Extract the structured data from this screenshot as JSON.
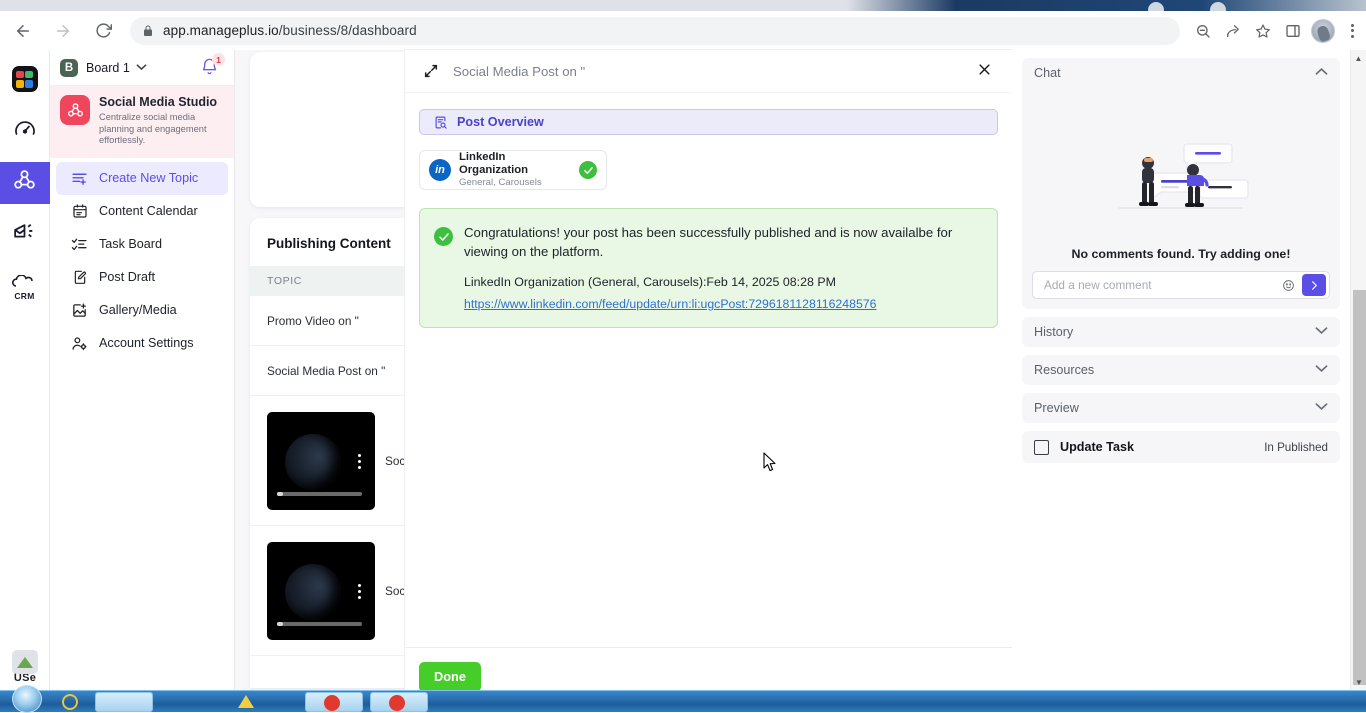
{
  "browser": {
    "url_host": "app.manageplus.io",
    "url_path": "/business/8/dashboard",
    "back_icon": "back-arrow-icon",
    "forward_icon": "forward-arrow-icon",
    "reload_icon": "reload-icon",
    "lock_icon": "lock-icon",
    "zoom_icon": "zoom-out-icon",
    "share_icon": "share-icon",
    "bookmark_icon": "star-icon",
    "sidepanel_icon": "side-panel-icon",
    "profile_icon": "avatar-icon",
    "menu_icon": "three-dot-menu-icon"
  },
  "rail": {
    "items": [
      {
        "name": "app-logo",
        "icon": "grid-logo-icon"
      },
      {
        "name": "dashboard",
        "icon": "speedometer-icon"
      },
      {
        "name": "social-media-studio",
        "icon": "people-group-icon",
        "active": true
      },
      {
        "name": "campaigns",
        "icon": "megaphone-mail-icon"
      },
      {
        "name": "crm",
        "icon": "crm-cloud-icon"
      }
    ],
    "bottom_label": "USe"
  },
  "sidebar": {
    "board_badge": "B",
    "board_name": "Board 1",
    "board_caret": "▾",
    "notification_count": "1",
    "studio": {
      "title": "Social Media Studio",
      "subtitle": "Centralize social media planning and engagement effortlessly."
    },
    "items": [
      {
        "label": "Create New Topic",
        "icon": "list-plus-icon",
        "active": true
      },
      {
        "label": "Content Calendar",
        "icon": "calendar-icon",
        "active": false
      },
      {
        "label": "Task Board",
        "icon": "checklist-icon",
        "active": false
      },
      {
        "label": "Post Draft",
        "icon": "document-edit-icon",
        "active": false
      },
      {
        "label": "Gallery/Media",
        "icon": "image-plus-icon",
        "active": false
      },
      {
        "label": "Account Settings",
        "icon": "user-gear-icon",
        "active": false
      }
    ]
  },
  "publishing": {
    "title": "Publishing Content",
    "column_header": "TOPIC",
    "rows": [
      {
        "topic": "Promo Video on \"",
        "type": "text"
      },
      {
        "topic": "Social Media Post on \"",
        "type": "text"
      },
      {
        "topic": "Soc",
        "type": "media"
      },
      {
        "topic": "Soc",
        "type": "media"
      }
    ]
  },
  "modal": {
    "title": "Social Media Post on \"",
    "expand_icon": "expand-arrows-icon",
    "close_icon": "close-x-icon",
    "section_label": "Post Overview",
    "section_icon": "document-search-icon",
    "account": {
      "platform_icon": "linkedin-icon",
      "platform_short": "in",
      "name": "LinkedIn Organization",
      "subtitle": "General, Carousels",
      "status_icon": "check-circle-icon"
    },
    "success": {
      "status_icon": "check-circle-icon",
      "message": "Congratulations! your post has been successfully published and is now availalbe for viewing on the platform.",
      "detail": "LinkedIn Organization (General, Carousels):Feb 14, 2025 08:28 PM",
      "link": "https://www.linkedin.com/feed/update/urn:li:ugcPost:7296181128116248576"
    },
    "done_label": "Done"
  },
  "right_panel": {
    "chat": {
      "title": "Chat",
      "chevron": "chevron-up-icon",
      "empty_text": "No comments found. Try adding one!",
      "input_placeholder": "Add a new comment",
      "input_value": "",
      "emoji_icon": "emoji-smiley-icon",
      "send_icon": "send-arrow-icon"
    },
    "sections": [
      {
        "title": "History",
        "chevron": "chevron-down-icon"
      },
      {
        "title": "Resources",
        "chevron": "chevron-down-icon"
      },
      {
        "title": "Preview",
        "chevron": "chevron-down-icon"
      }
    ],
    "task": {
      "label": "Update Task",
      "status": "In Published",
      "checked": false
    }
  },
  "colors": {
    "accent": "#5b4ee5",
    "success": "#3fbf3f",
    "done_button": "#46cd2a",
    "linkedin": "#0a66c2",
    "studio_card": "#fdeff1",
    "studio_logo": "#f0465d"
  },
  "scrollbar": {
    "up_arrow": "▲",
    "down_arrow": "▼"
  }
}
